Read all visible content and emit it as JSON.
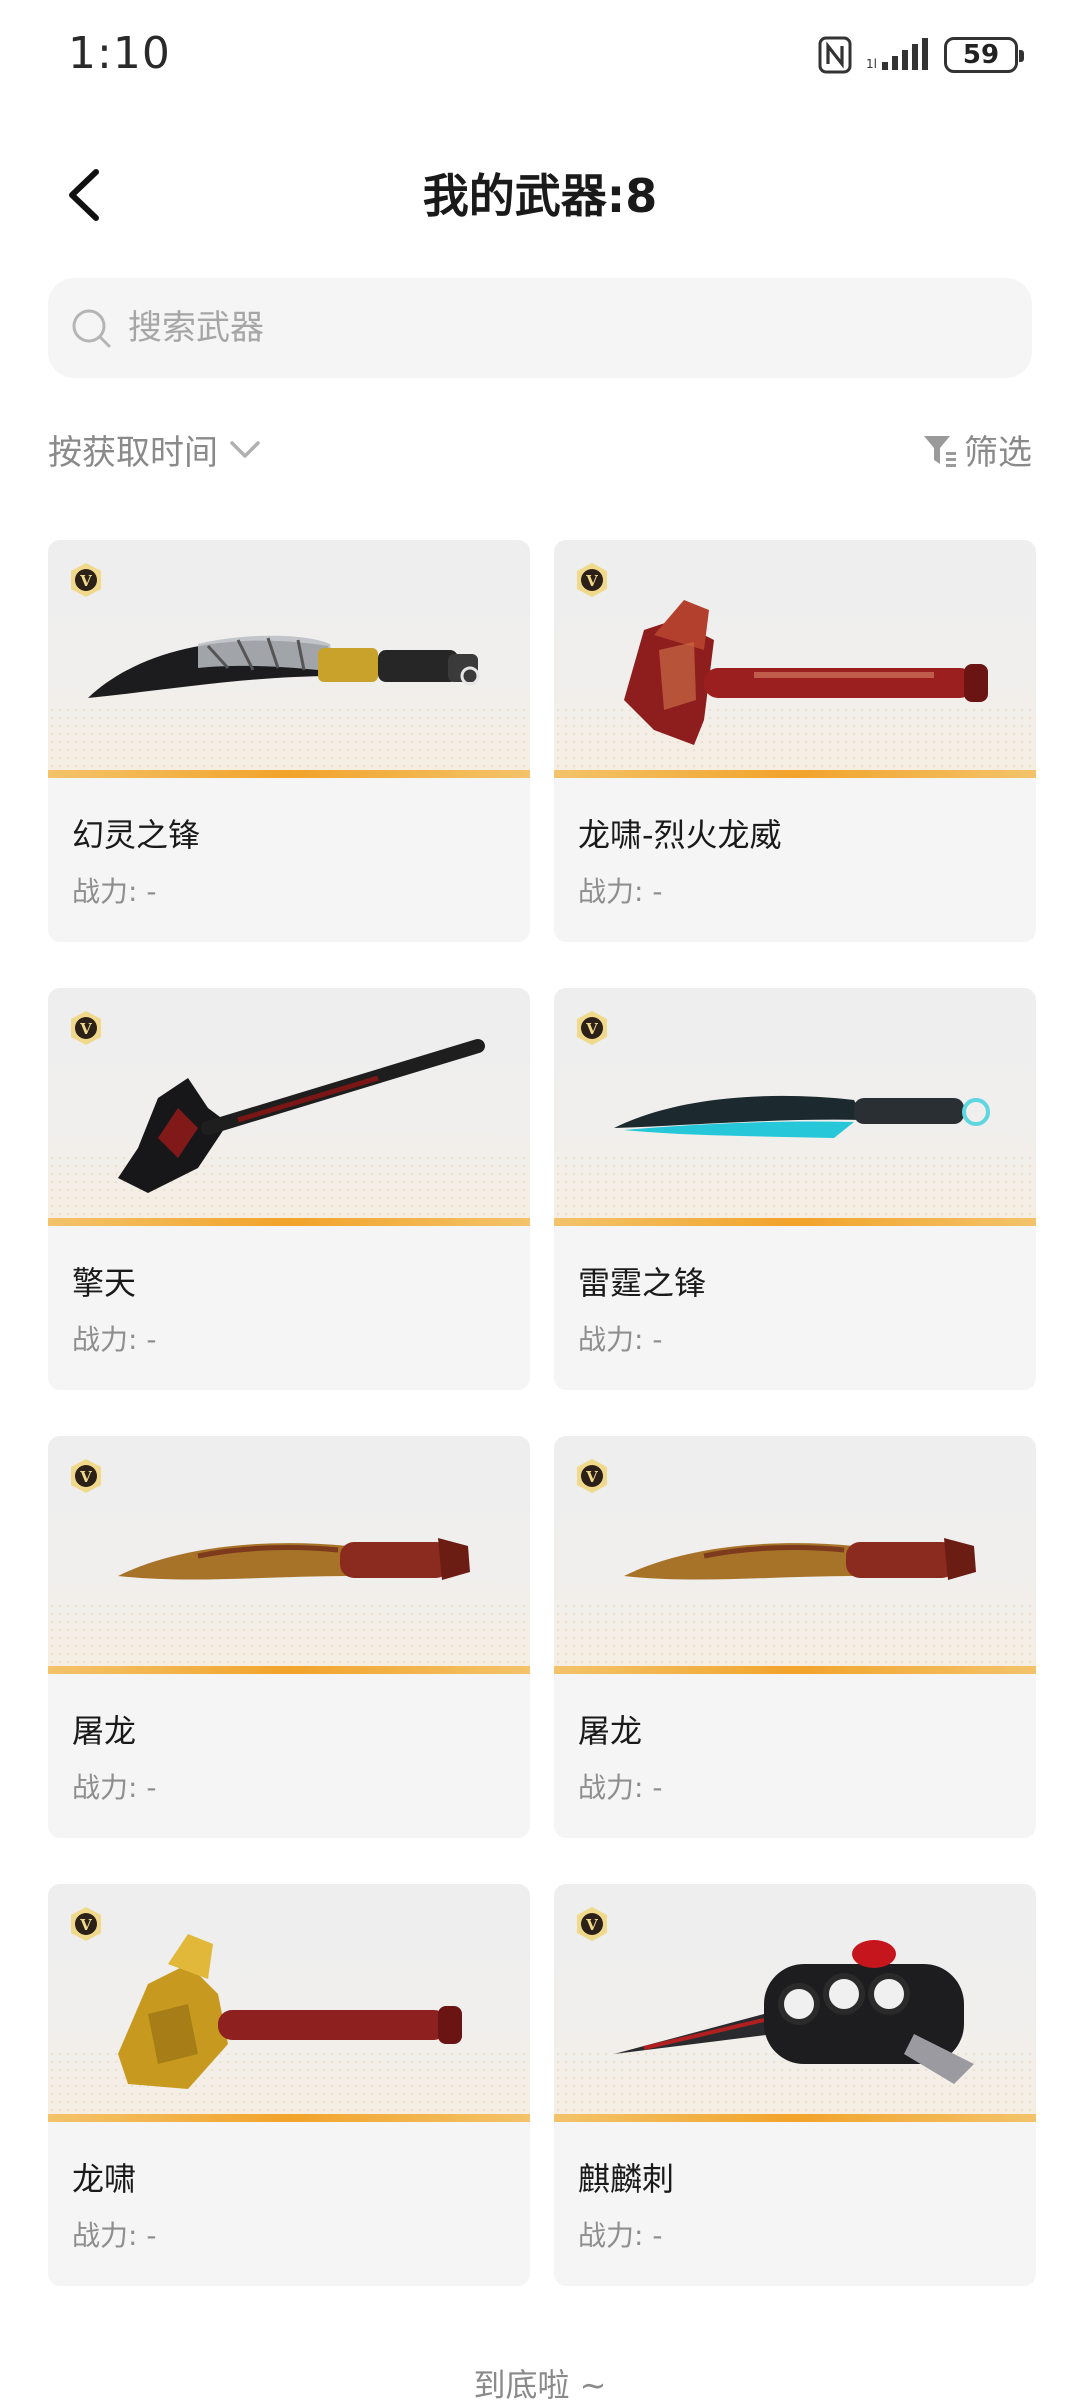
{
  "status_bar": {
    "time": "1:10",
    "battery": "59"
  },
  "header": {
    "title": "我的武器:8"
  },
  "search": {
    "placeholder": "搜索武器"
  },
  "toolbar": {
    "sort_label": "按获取时间",
    "filter_label": "筛选"
  },
  "weapons": [
    {
      "name": "幻灵之锋",
      "power": "战力: -",
      "badge": "V",
      "icon": "kukri-knife"
    },
    {
      "name": "龙啸-烈火龙威",
      "power": "战力: -",
      "badge": "V",
      "icon": "dragon-axe-red"
    },
    {
      "name": "擎天",
      "power": "战力: -",
      "badge": "V",
      "icon": "shovel"
    },
    {
      "name": "雷霆之锋",
      "power": "战力: -",
      "badge": "V",
      "icon": "curved-blade-cyan"
    },
    {
      "name": "屠龙",
      "power": "战力: -",
      "badge": "V",
      "icon": "kukri-gold"
    },
    {
      "name": "屠龙",
      "power": "战力: -",
      "badge": "V",
      "icon": "kukri-gold"
    },
    {
      "name": "龙啸",
      "power": "战力: -",
      "badge": "V",
      "icon": "dragon-axe-gold"
    },
    {
      "name": "麒麟刺",
      "power": "战力: -",
      "badge": "V",
      "icon": "knuckle-dagger"
    }
  ],
  "footer": {
    "end_text": "到底啦 ~"
  },
  "colors": {
    "accent_bar": "#f2a32a",
    "card_bg": "#f5f5f5"
  }
}
